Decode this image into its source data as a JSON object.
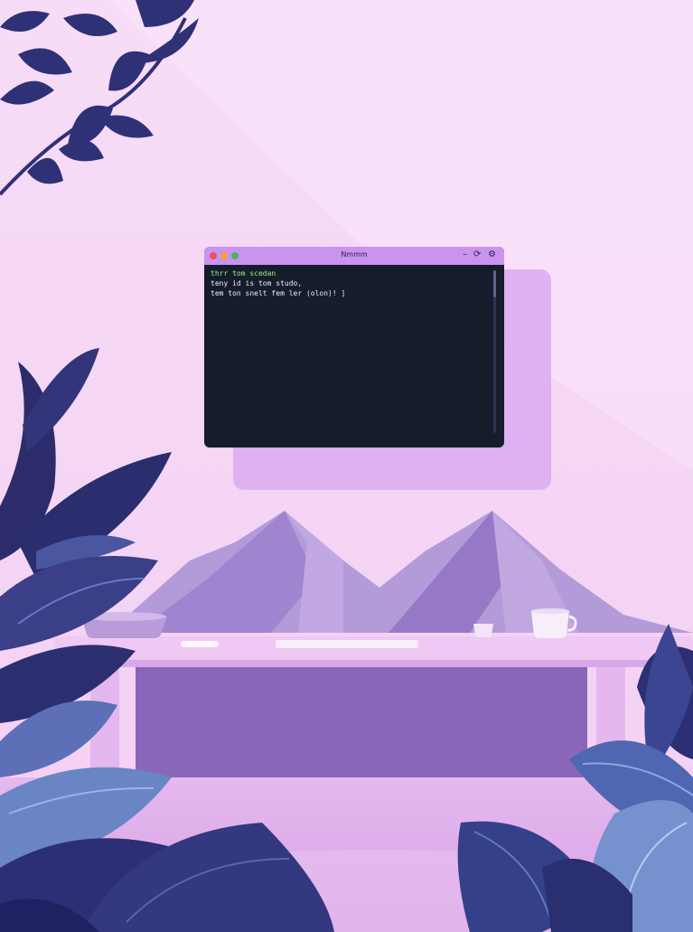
{
  "terminal": {
    "window_title": "Nmmm",
    "lines": [
      "thrr tom scedan",
      "teny id is tom studo,",
      "tem ton snelt fem ler (olon)! ]"
    ],
    "controls": {
      "minimize_icon": "minus-icon",
      "refresh_icon": "refresh-icon",
      "settings_icon": "gear-icon"
    }
  },
  "colors": {
    "wall": "#f6d6f6",
    "terminal_bg": "#151c2c",
    "titlebar": "#c993ee",
    "prompt_green": "#a6ea7a",
    "mountain": "#a98ad6",
    "desk": "#efc6f2",
    "plant_dark": "#2a2f6e"
  }
}
